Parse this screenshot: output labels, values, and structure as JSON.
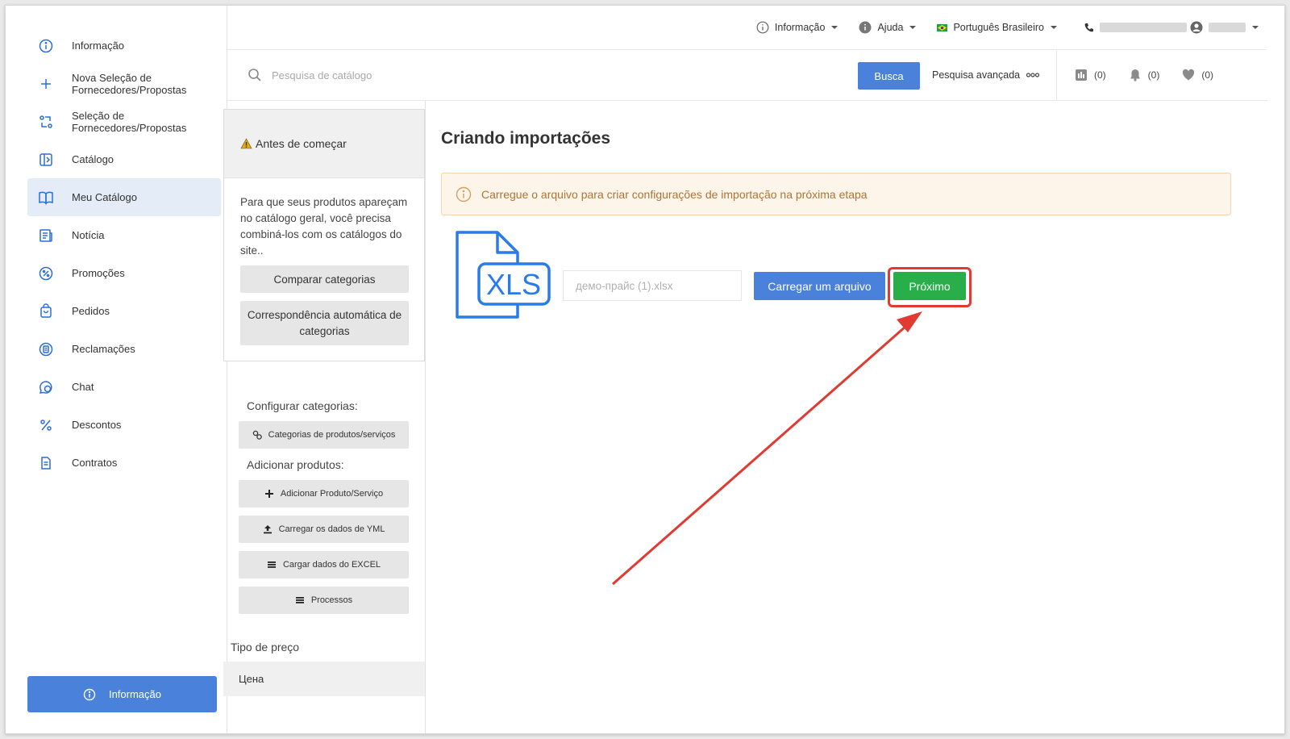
{
  "sidebar": {
    "items": [
      {
        "label": "Informação",
        "icon": "info-icon"
      },
      {
        "label": "Nova Seleção de Fornecedores/Propostas",
        "icon": "plus-icon"
      },
      {
        "label": "Seleção de Fornecedores/Propostas",
        "icon": "exchange-icon"
      },
      {
        "label": "Catálogo",
        "icon": "catalog-icon"
      },
      {
        "label": "Meu Catálogo",
        "icon": "book-icon",
        "active": true
      },
      {
        "label": "Notícia",
        "icon": "news-icon"
      },
      {
        "label": "Promoções",
        "icon": "promo-icon"
      },
      {
        "label": "Pedidos",
        "icon": "bag-icon"
      },
      {
        "label": "Reclamações",
        "icon": "complaint-icon"
      },
      {
        "label": "Chat",
        "icon": "chat-icon"
      },
      {
        "label": "Descontos",
        "icon": "percent-icon"
      },
      {
        "label": "Contratos",
        "icon": "contract-icon"
      }
    ],
    "info_button": "Informação"
  },
  "topbar": {
    "info": "Informação",
    "help": "Ajuda",
    "language": "Português Brasileiro"
  },
  "search": {
    "placeholder": "Pesquisa de catálogo",
    "button": "Busca",
    "advanced": "Pesquisa avançada"
  },
  "counters": {
    "compare": "(0)",
    "notifications": "(0)",
    "favorites": "(0)"
  },
  "midcol": {
    "before_title": "Antes de começar",
    "before_text": "Para que seus produtos apareçam no catálogo geral, você precisa combiná-los com os catálogos do site..",
    "compare_btn": "Comparar categorias",
    "auto_btn": "Correspondência automática de categorias",
    "config_label": "Configurar categorias:",
    "categories_btn": "Categorias de produtos/serviços",
    "add_label": "Adicionar produtos:",
    "add_btn": "Adicionar Produto/Serviço",
    "yml_btn": "Carregar os dados de YML",
    "excel_btn": "Cargar dados do EXCEL",
    "process_btn": "Processos",
    "price_label": "Tipo de preço",
    "price_value": "Цена"
  },
  "main": {
    "title": "Criando importações",
    "alert": "Carregue o arquivo para criar configurações de importação na próxima etapa",
    "file_icon_label": "XLS",
    "file_name": "демо-прайс (1).xlsx",
    "upload_btn": "Carregar um arquivo",
    "next_btn": "Próximo"
  },
  "colors": {
    "accent": "#4a82db",
    "next": "#2aae4a",
    "highlight": "#e13a32",
    "icon": "#2a6fd6"
  }
}
